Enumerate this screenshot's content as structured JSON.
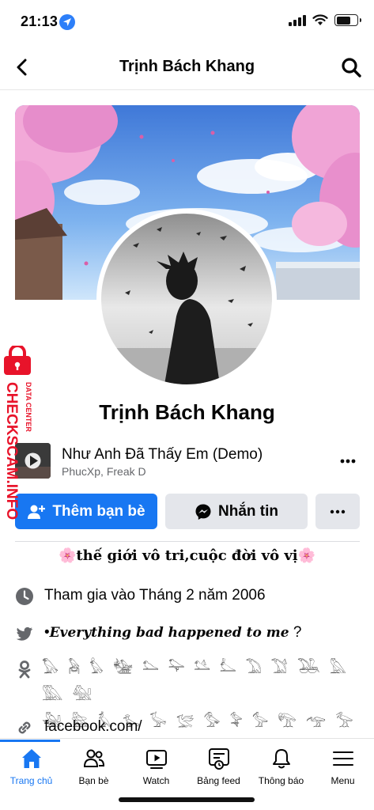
{
  "status_bar": {
    "time": "21:13"
  },
  "nav": {
    "title": "Trịnh Bách Khang"
  },
  "profile": {
    "name": "Trịnh Bách Khang"
  },
  "music": {
    "title": "Như Anh Đã Thấy Em (Demo)",
    "artist": "PhucXp, Freak D"
  },
  "actions": {
    "add_friend": "Thêm bạn bè",
    "message": "Nhắn tin"
  },
  "bio": "🌸thế giới vô tri,cuộc đời vô vị🌸",
  "info": {
    "joined": "Tham gia vào Tháng 2 năm 2006",
    "twitter_bullet": "•",
    "twitter": "Everything bad happened to me",
    "twitter_suffix": " ?",
    "glyphs_line1": "𓅃 𓅉 𓅊 𓅋 𓅌 𓅍 𓅎 𓅏 𓅐 𓅑 𓅒 𓅓 𓅔 𓅕",
    "glyphs_line2": "𓅖 𓅗 𓅘 𓅙 𓅚 𓅛 𓅜 𓅝 𓅞 𓅟 𓅠 𓅡 𓅢...",
    "link": "facebook.com/"
  },
  "tabs": [
    {
      "label": "Trang chủ",
      "icon": "home-icon",
      "active": true
    },
    {
      "label": "Bạn bè",
      "icon": "friends-icon",
      "active": false
    },
    {
      "label": "Watch",
      "icon": "watch-icon",
      "active": false
    },
    {
      "label": "Bảng feed",
      "icon": "feed-icon",
      "active": false
    },
    {
      "label": "Thông báo",
      "icon": "bell-icon",
      "active": false
    },
    {
      "label": "Menu",
      "icon": "menu-icon",
      "active": false
    }
  ],
  "watermark": {
    "main": "CHECKSCAM.INFO",
    "sub": "DATA CENTER"
  },
  "colors": {
    "accent": "#1877f2",
    "button_gray": "#e4e6eb",
    "watermark_red": "#e8132a"
  }
}
